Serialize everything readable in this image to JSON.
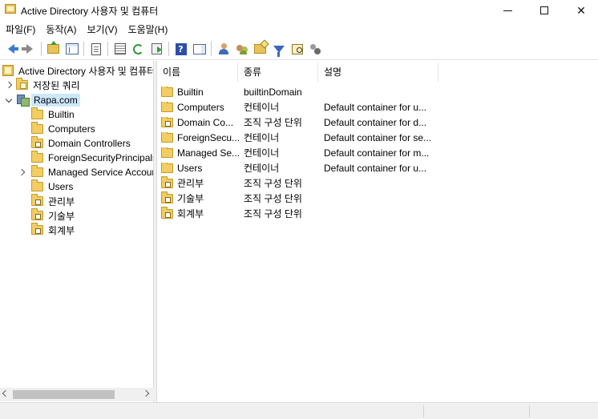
{
  "window": {
    "title": "Active Directory 사용자 및 컴퓨터",
    "minimize_icon": "minimize-icon",
    "maximize_icon": "maximize-icon",
    "close_glyph": "✕"
  },
  "menubar": {
    "items": [
      {
        "label": "파일(F)"
      },
      {
        "label": "동작(A)"
      },
      {
        "label": "보기(V)"
      },
      {
        "label": "도움말(H)"
      }
    ]
  },
  "toolbar": {
    "icons": [
      "back-icon",
      "forward-icon",
      "up-folder-icon",
      "show-tree-icon",
      "properties-icon",
      "export-list-icon",
      "refresh-icon",
      "export-icon",
      "help-icon",
      "action-pane-icon",
      "new-user-icon",
      "new-group-icon",
      "new-ou-icon",
      "filter-icon",
      "find-icon",
      "delegate-icon"
    ]
  },
  "tree": {
    "root": "Active Directory 사용자 및 컴퓨터",
    "items": [
      {
        "label": "저장된 쿼리"
      },
      {
        "label": "Rapa.com"
      },
      {
        "label": "Builtin"
      },
      {
        "label": "Computers"
      },
      {
        "label": "Domain Controllers"
      },
      {
        "label": "ForeignSecurityPrincipals"
      },
      {
        "label": "Managed Service Accounts"
      },
      {
        "label": "Users"
      },
      {
        "label": "관리부"
      },
      {
        "label": "기술부"
      },
      {
        "label": "회계부"
      }
    ]
  },
  "list": {
    "columns": {
      "name": "이름",
      "type": "종류",
      "description": "설명"
    },
    "rows": [
      {
        "name": "Builtin",
        "type": "builtinDomain",
        "description": ""
      },
      {
        "name": "Computers",
        "type": "컨테이너",
        "description": "Default container for u..."
      },
      {
        "name": "Domain Co...",
        "type": "조직 구성 단위",
        "description": "Default container for d..."
      },
      {
        "name": "ForeignSecu...",
        "type": "컨테이너",
        "description": "Default container for se..."
      },
      {
        "name": "Managed Se...",
        "type": "컨테이너",
        "description": "Default container for m..."
      },
      {
        "name": "Users",
        "type": "컨테이너",
        "description": "Default container for u..."
      },
      {
        "name": "관리부",
        "type": "조직 구성 단위",
        "description": ""
      },
      {
        "name": "기술부",
        "type": "조직 구성 단위",
        "description": ""
      },
      {
        "name": "회계부",
        "type": "조직 구성 단위",
        "description": ""
      }
    ]
  }
}
